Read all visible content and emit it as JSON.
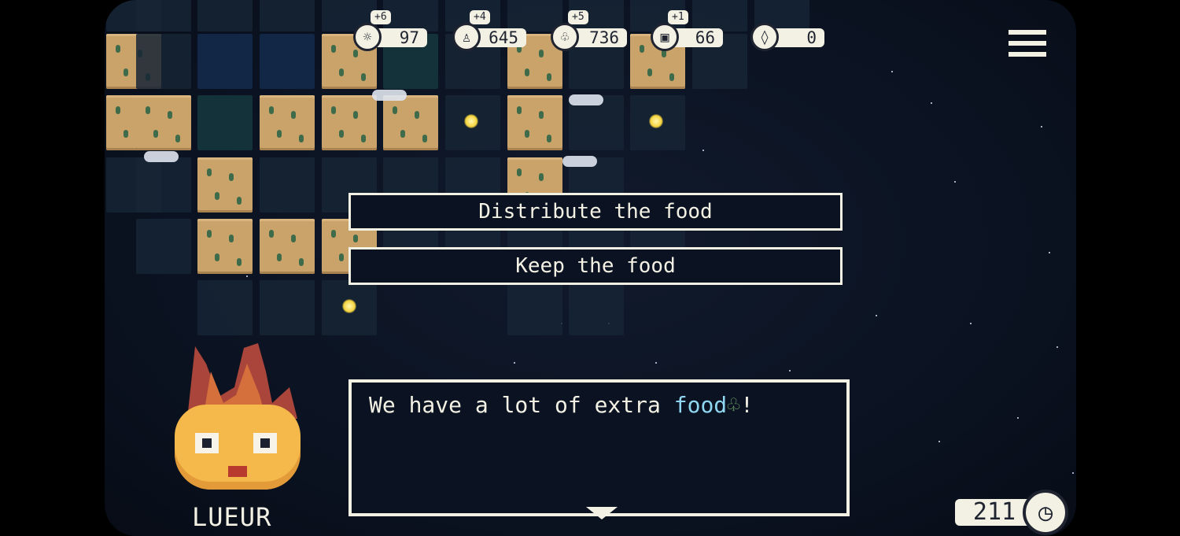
{
  "resources": [
    {
      "icon": "sun-icon",
      "glyph": "☼",
      "value": "97",
      "delta": "+6"
    },
    {
      "icon": "population-icon",
      "glyph": "♙",
      "value": "645",
      "delta": "+4"
    },
    {
      "icon": "food-corn-icon",
      "glyph": "♧",
      "value": "736",
      "delta": "+5"
    },
    {
      "icon": "material-crate-icon",
      "glyph": "▣",
      "value": "66",
      "delta": "+1"
    },
    {
      "icon": "crystal-icon",
      "glyph": "◊",
      "value": "0",
      "delta": ""
    }
  ],
  "choices": {
    "distribute": "Distribute the food",
    "keep": "Keep the food"
  },
  "dialog": {
    "text_before": "We have a lot of extra ",
    "highlight": "food",
    "text_after": "!"
  },
  "speaker": "LUEUR",
  "timer": {
    "value": "211"
  },
  "colors": {
    "accent_food": "#8fd6f0",
    "ui_light": "#f3f1e4",
    "background": "#0b1322",
    "sand": "#c9a36a"
  }
}
